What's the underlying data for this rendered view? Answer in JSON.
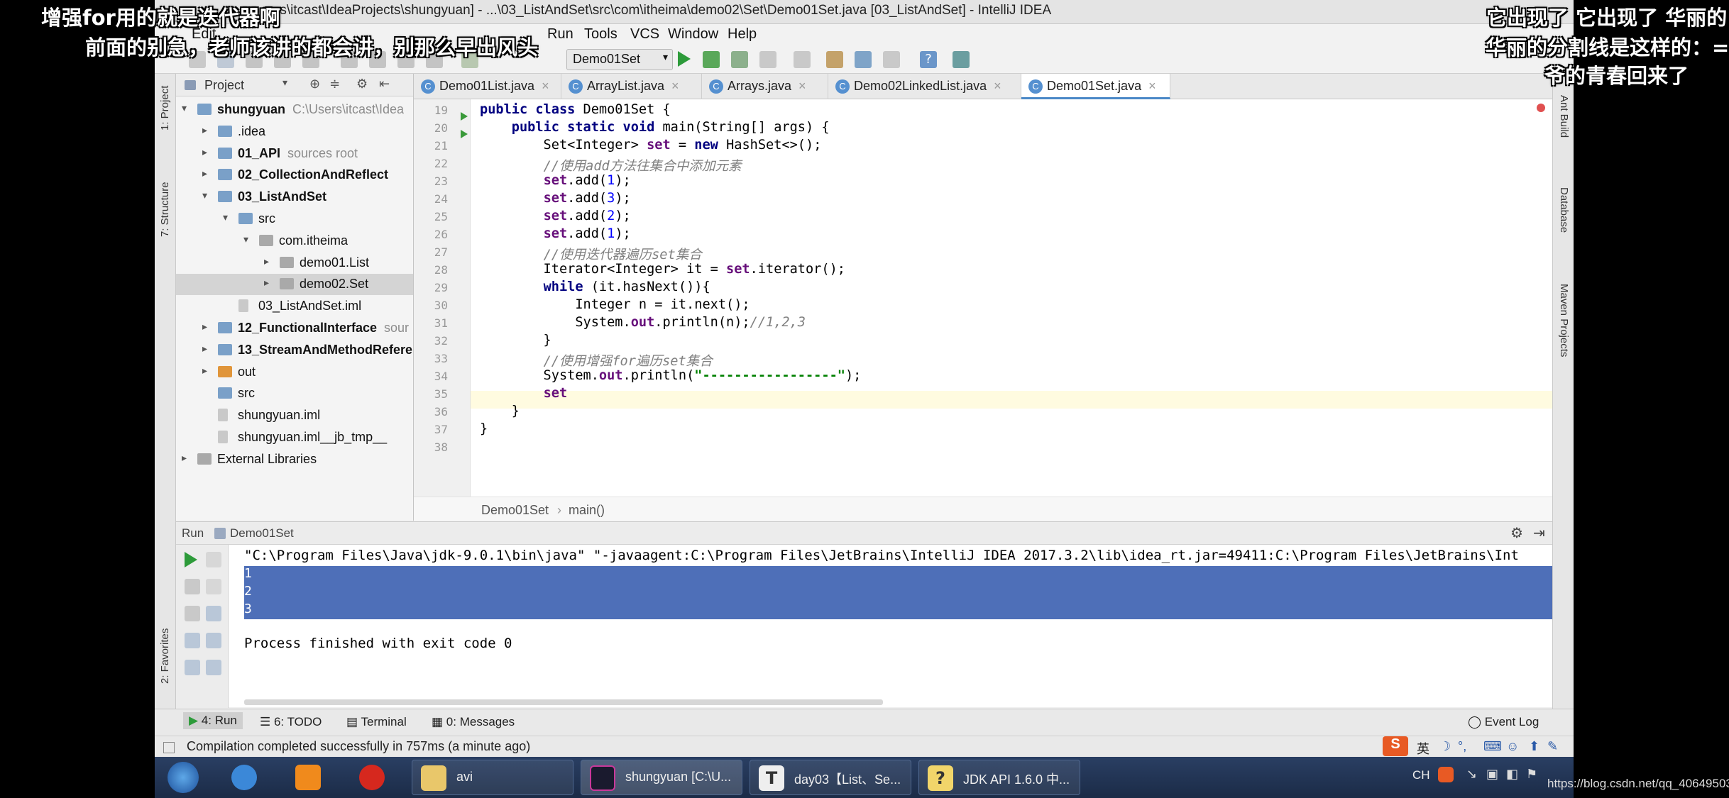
{
  "window": {
    "title": "sers\\itcast\\IdeaProjects\\shungyuan] - ...\\03_ListAndSet\\src\\com\\itheima\\demo02\\Set\\Demo01Set.java [03_ListAndSet] - IntelliJ IDEA"
  },
  "menu": [
    "Edit",
    "Run",
    "Tools",
    "VCS",
    "Window",
    "Help"
  ],
  "toolbar": {
    "run_config": "Demo01Set"
  },
  "left_strip": {
    "project": "1: Project",
    "structure": "7: Structure",
    "favorites": "2: Favorites"
  },
  "right_strip": {
    "ant": "Ant Build",
    "database": "Database",
    "maven": "Maven Projects"
  },
  "project": {
    "header": "Project",
    "tree": [
      {
        "name": "shungyuan",
        "hint": "C:\\Users\\itcast\\Idea",
        "bold": true,
        "indent": 0,
        "arrow": "▾",
        "icon": "folder"
      },
      {
        "name": ".idea",
        "hint": "",
        "bold": false,
        "indent": 1,
        "arrow": "▸",
        "icon": "folder"
      },
      {
        "name": "01_API",
        "hint": "sources root",
        "bold": true,
        "indent": 1,
        "arrow": "▸",
        "icon": "folder"
      },
      {
        "name": "02_CollectionAndReflect",
        "hint": "",
        "bold": true,
        "indent": 1,
        "arrow": "▸",
        "icon": "folder"
      },
      {
        "name": "03_ListAndSet",
        "hint": "",
        "bold": true,
        "indent": 1,
        "arrow": "▾",
        "icon": "folder"
      },
      {
        "name": "src",
        "hint": "",
        "bold": false,
        "indent": 2,
        "arrow": "▾",
        "icon": "folder"
      },
      {
        "name": "com.itheima",
        "hint": "",
        "bold": false,
        "indent": 3,
        "arrow": "▾",
        "icon": "package"
      },
      {
        "name": "demo01.List",
        "hint": "",
        "bold": false,
        "indent": 4,
        "arrow": "▸",
        "icon": "package"
      },
      {
        "name": "demo02.Set",
        "hint": "",
        "bold": false,
        "indent": 4,
        "arrow": "▸",
        "icon": "package",
        "selected": true
      },
      {
        "name": "03_ListAndSet.iml",
        "hint": "",
        "bold": false,
        "indent": 2,
        "arrow": "",
        "icon": "file"
      },
      {
        "name": "12_FunctionalInterface",
        "hint": "sour",
        "bold": true,
        "indent": 1,
        "arrow": "▸",
        "icon": "folder"
      },
      {
        "name": "13_StreamAndMethodRefere",
        "hint": "",
        "bold": true,
        "indent": 1,
        "arrow": "▸",
        "icon": "folder"
      },
      {
        "name": "out",
        "hint": "",
        "bold": false,
        "indent": 1,
        "arrow": "▸",
        "icon": "orange"
      },
      {
        "name": "src",
        "hint": "",
        "bold": false,
        "indent": 1,
        "arrow": "",
        "icon": "folder"
      },
      {
        "name": "shungyuan.iml",
        "hint": "",
        "bold": false,
        "indent": 1,
        "arrow": "",
        "icon": "file"
      },
      {
        "name": "shungyuan.iml__jb_tmp__",
        "hint": "",
        "bold": false,
        "indent": 1,
        "arrow": "",
        "icon": "file"
      },
      {
        "name": "External Libraries",
        "hint": "",
        "bold": false,
        "indent": 0,
        "arrow": "▸",
        "icon": "lib"
      }
    ]
  },
  "tabs": [
    {
      "label": "Demo01List.java",
      "active": false
    },
    {
      "label": "ArrayList.java",
      "active": false
    },
    {
      "label": "Arrays.java",
      "active": false
    },
    {
      "label": "Demo02LinkedList.java",
      "active": false
    },
    {
      "label": "Demo01Set.java",
      "active": true
    }
  ],
  "editor": {
    "lines": [
      {
        "n": "19",
        "code": [
          [
            "kw",
            "public class "
          ],
          [
            "",
            "Demo01Set {"
          ]
        ]
      },
      {
        "n": "20",
        "code": [
          [
            "",
            "    "
          ],
          [
            "kw",
            "public static void "
          ],
          [
            "",
            "main(String[] args) {"
          ]
        ]
      },
      {
        "n": "21",
        "code": [
          [
            "",
            "        Set<Integer> "
          ],
          [
            "fld",
            "set"
          ],
          [
            "",
            " = "
          ],
          [
            "kw",
            "new "
          ],
          [
            "",
            "HashSet<>();"
          ]
        ]
      },
      {
        "n": "22",
        "code": [
          [
            "",
            "        "
          ],
          [
            "cm",
            "//使用add方法往集合中添加元素"
          ]
        ]
      },
      {
        "n": "23",
        "code": [
          [
            "",
            "        "
          ],
          [
            "fld",
            "set"
          ],
          [
            "",
            ".add("
          ],
          [
            "num",
            "1"
          ],
          [
            "",
            ");"
          ]
        ]
      },
      {
        "n": "24",
        "code": [
          [
            "",
            "        "
          ],
          [
            "fld",
            "set"
          ],
          [
            "",
            ".add("
          ],
          [
            "num",
            "3"
          ],
          [
            "",
            ");"
          ]
        ]
      },
      {
        "n": "25",
        "code": [
          [
            "",
            "        "
          ],
          [
            "fld",
            "set"
          ],
          [
            "",
            ".add("
          ],
          [
            "num",
            "2"
          ],
          [
            "",
            ");"
          ]
        ]
      },
      {
        "n": "26",
        "code": [
          [
            "",
            "        "
          ],
          [
            "fld",
            "set"
          ],
          [
            "",
            ".add("
          ],
          [
            "num",
            "1"
          ],
          [
            "",
            ");"
          ]
        ]
      },
      {
        "n": "27",
        "code": [
          [
            "",
            "        "
          ],
          [
            "cm",
            "//使用迭代器遍历set集合"
          ]
        ]
      },
      {
        "n": "28",
        "code": [
          [
            "",
            "        Iterator<Integer> it = "
          ],
          [
            "fld",
            "set"
          ],
          [
            "",
            ".iterator();"
          ]
        ]
      },
      {
        "n": "29",
        "code": [
          [
            "",
            "        "
          ],
          [
            "kw",
            "while "
          ],
          [
            "",
            "(it.hasNext()){"
          ]
        ]
      },
      {
        "n": "30",
        "code": [
          [
            "",
            "            Integer n = it.next();"
          ]
        ]
      },
      {
        "n": "31",
        "code": [
          [
            "",
            "            System."
          ],
          [
            "fld",
            "out"
          ],
          [
            "",
            ".println(n);"
          ],
          [
            "cm",
            "//1,2,3"
          ]
        ]
      },
      {
        "n": "32",
        "code": [
          [
            "",
            "        }"
          ]
        ]
      },
      {
        "n": "33",
        "code": [
          [
            "",
            "        "
          ],
          [
            "cm",
            "//使用增强for遍历set集合"
          ]
        ]
      },
      {
        "n": "34",
        "code": [
          [
            "",
            "        System."
          ],
          [
            "fld",
            "out"
          ],
          [
            "",
            ".println("
          ],
          [
            "str",
            "\"-----------------\""
          ],
          [
            "",
            ");"
          ]
        ]
      },
      {
        "n": "35",
        "code": [
          [
            "",
            "        "
          ],
          [
            "fld",
            "set"
          ]
        ]
      },
      {
        "n": "36",
        "code": [
          [
            "",
            "    }"
          ]
        ]
      },
      {
        "n": "37",
        "code": [
          [
            "",
            "}"
          ]
        ]
      },
      {
        "n": "38",
        "code": []
      }
    ],
    "breadcrumb": [
      "Demo01Set",
      "main()"
    ]
  },
  "run": {
    "header_label": "Run",
    "config": "Demo01Set",
    "command": "\"C:\\Program Files\\Java\\jdk-9.0.1\\bin\\java\" \"-javaagent:C:\\Program Files\\JetBrains\\IntelliJ IDEA 2017.3.2\\lib\\idea_rt.jar=49411:C:\\Program Files\\JetBrains\\Int",
    "output": [
      "1",
      "2",
      "3"
    ],
    "exit": "Process finished with exit code 0"
  },
  "bottom_tabs": {
    "run": "4: Run",
    "todo": "6: TODO",
    "terminal": "Terminal",
    "messages": "0: Messages",
    "event_log": "Event Log"
  },
  "status": "Compilation completed successfully in 757ms (a minute ago)",
  "taskbar": {
    "items": [
      "avi",
      "shungyuan [C:\\U...",
      "day03【List、Se...",
      "JDK API 1.6.0 中..."
    ],
    "tray_text": "CH",
    "ime_label": "英"
  },
  "overlays": {
    "danmaku": [
      "增强for用的就是迭代器啊",
      "前面的别急，老师该讲的都会讲，别那么早出风头",
      "它出现了 它出现了 华丽的",
      "华丽的分割线是这样的：=",
      "爷的青春回来了"
    ],
    "watermark": "https://blog.csdn.net/qq_40649503"
  }
}
